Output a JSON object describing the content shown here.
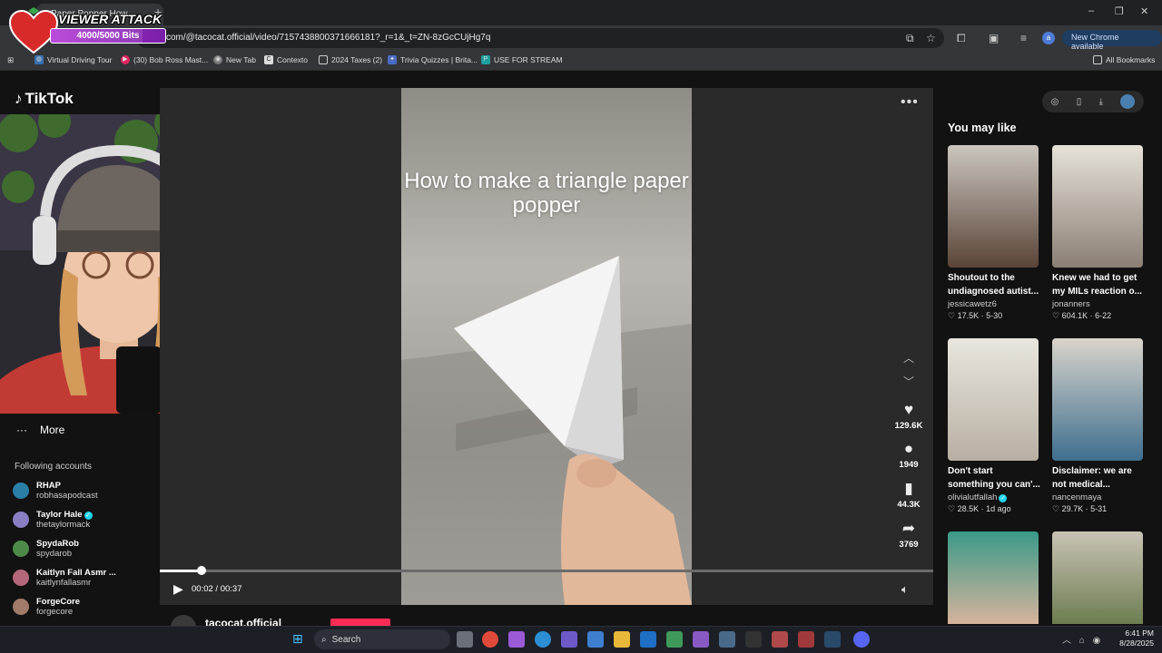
{
  "browser": {
    "tab_title": "Paper Popper How",
    "new_tab_symbol": "+",
    "url": "com/@tacocat.official/video/7157438800371666181?_r=1&_t=ZN-8zGcCUjHg7q",
    "new_chrome_label": "New Chrome available",
    "profile_initial": "a",
    "window_controls": [
      "–",
      "❐",
      "✕"
    ],
    "bookmarks": [
      {
        "label": "Virtual Driving Tour",
        "icon": "globe-icon"
      },
      {
        "label": "(30) Bob Ross Mast...",
        "icon": "youtube-icon"
      },
      {
        "label": "New Tab",
        "icon": "chrome-icon"
      },
      {
        "label": "Contexto",
        "icon": "contexto-icon"
      },
      {
        "label": "2024 Taxes (2)",
        "icon": "folder-icon"
      },
      {
        "label": "Trivia Quizzes | Brita...",
        "icon": "britannica-icon"
      },
      {
        "label": "USE FOR STREAM",
        "icon": "p-icon"
      }
    ],
    "all_bookmarks_label": "All Bookmarks"
  },
  "overlay": {
    "title": "VIEWER ATTACK",
    "bits": "4000/5000 Bits",
    "bits_progress": 0.8
  },
  "tiktok": {
    "logo_text": "TikTok",
    "more_label": "More",
    "following_title": "Following accounts",
    "accounts": [
      {
        "name": "RHAP",
        "handle": "robhasapodcast",
        "verified": false,
        "color": "#2a7fa6"
      },
      {
        "name": "Taylor Hale",
        "handle": "thetaylormack",
        "verified": true,
        "color": "#8a7fc4"
      },
      {
        "name": "SpydaRob",
        "handle": "spydarob",
        "verified": false,
        "color": "#4d8a4a"
      },
      {
        "name": "Kaitlyn Fall Asmr ...",
        "handle": "kaitlynfallasmr",
        "verified": false,
        "color": "#b4677a"
      },
      {
        "name": "ForgeCore",
        "handle": "forgecore",
        "verified": false,
        "color": "#a07b6a"
      }
    ],
    "video": {
      "caption": "How to make a triangle paper popper",
      "current_time": "00:02",
      "duration": "00:37",
      "time_separator": " / ",
      "progress": 0.054,
      "author": "tacocat.official"
    },
    "actions": {
      "likes": "129.6K",
      "comments": "1949",
      "saves": "44.3K",
      "shares": "3769"
    },
    "you_may_like": "You may like",
    "recommended": [
      {
        "title": "Shoutout to the undiagnosed autist...",
        "author": "jessicawetz6",
        "verified": false,
        "likes": "17.5K",
        "date": "5-30",
        "thumb": "#4a3b36"
      },
      {
        "title": "Knew we had to get my MILs reaction o...",
        "author": "jonanners",
        "verified": false,
        "likes": "604.1K",
        "date": "6-22",
        "thumb": "#8a8478"
      },
      {
        "title": "Don't start something you can'...",
        "author": "olivialutfallah",
        "verified": true,
        "likes": "28.5K",
        "date": "1d ago",
        "thumb": "#c9c6bd"
      },
      {
        "title": "Disclaimer: we are not medical...",
        "author": "nancenmaya",
        "verified": false,
        "likes": "29.7K",
        "date": "5-31",
        "thumb": "#4f7fa0"
      },
      {
        "title": "",
        "author": "",
        "verified": false,
        "likes": "",
        "date": "",
        "thumb": "#2f8a78"
      },
      {
        "title": "",
        "author": "",
        "verified": false,
        "likes": "",
        "date": "",
        "thumb": "#6a7b4f"
      }
    ]
  },
  "taskbar": {
    "search_label": "Search",
    "time": "6:41 PM",
    "date": "8/28/2025"
  }
}
